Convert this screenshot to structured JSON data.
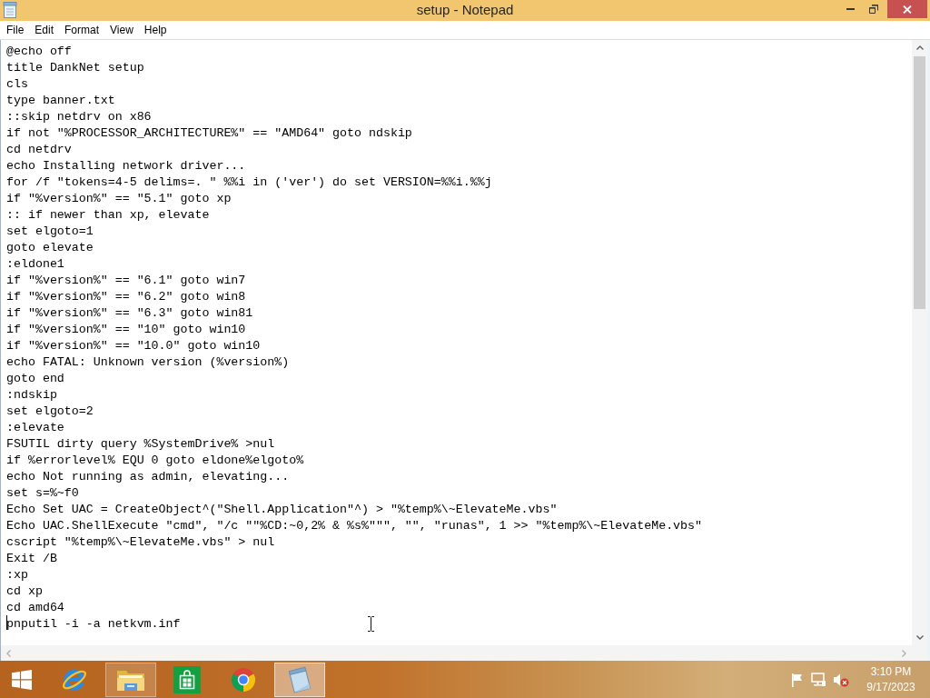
{
  "window": {
    "title": "setup - Notepad"
  },
  "menu": [
    "File",
    "Edit",
    "Format",
    "View",
    "Help"
  ],
  "lines": [
    {
      "text": "@echo off",
      "caret": false
    },
    {
      "text": "title DankNet setup",
      "caret": false
    },
    {
      "text": "cls",
      "caret": false
    },
    {
      "text": "type banner.txt",
      "caret": false
    },
    {
      "text": "::skip netdrv on x86",
      "caret": false
    },
    {
      "text": "if not \"%PROCESSOR_ARCHITECTURE%\" == \"AMD64\" goto ndskip",
      "caret": false
    },
    {
      "text": "cd netdrv",
      "caret": false
    },
    {
      "text": "echo Installing network driver...",
      "caret": false
    },
    {
      "text": "for /f \"tokens=4-5 delims=. \" %%i in ('ver') do set VERSION=%%i.%%j",
      "caret": false
    },
    {
      "text": "if \"%version%\" == \"5.1\" goto xp",
      "caret": false
    },
    {
      "text": ":: if newer than xp, elevate",
      "caret": false
    },
    {
      "text": "set elgoto=1",
      "caret": false
    },
    {
      "text": "goto elevate",
      "caret": false
    },
    {
      "text": ":eldone1",
      "caret": false
    },
    {
      "text": "if \"%version%\" == \"6.1\" goto win7",
      "caret": false
    },
    {
      "text": "if \"%version%\" == \"6.2\" goto win8",
      "caret": false
    },
    {
      "text": "if \"%version%\" == \"6.3\" goto win81",
      "caret": false
    },
    {
      "text": "if \"%version%\" == \"10\" goto win10",
      "caret": false
    },
    {
      "text": "if \"%version%\" == \"10.0\" goto win10",
      "caret": false
    },
    {
      "text": "echo FATAL: Unknown version (%version%)",
      "caret": false
    },
    {
      "text": "goto end",
      "caret": false
    },
    {
      "text": ":ndskip",
      "caret": false
    },
    {
      "text": "set elgoto=2",
      "caret": false
    },
    {
      "text": ":elevate",
      "caret": false
    },
    {
      "text": "FSUTIL dirty query %SystemDrive% >nul",
      "caret": false
    },
    {
      "text": "if %errorlevel% EQU 0 goto eldone%elgoto%",
      "caret": false
    },
    {
      "text": "echo Not running as admin, elevating...",
      "caret": false
    },
    {
      "text": "set s=%~f0",
      "caret": false
    },
    {
      "text": "Echo Set UAC = CreateObject^(\"Shell.Application\"^) > \"%temp%\\~ElevateMe.vbs\"",
      "caret": false
    },
    {
      "text": "Echo UAC.ShellExecute \"cmd\", \"/c \"\"%CD:~0,2% & %s%\"\"\", \"\", \"runas\", 1 >> \"%temp%\\~ElevateMe.vbs\"",
      "caret": false
    },
    {
      "text": "cscript \"%temp%\\~ElevateMe.vbs\" > nul",
      "caret": false
    },
    {
      "text": "Exit /B",
      "caret": false
    },
    {
      "text": ":xp",
      "caret": false
    },
    {
      "text": "cd xp",
      "caret": false
    },
    {
      "text": "cd amd64",
      "caret": false
    },
    {
      "text": "pnputil -i -a netkvm.inf",
      "caret": true
    }
  ],
  "taskbar": {
    "apps": [
      {
        "kind": "start",
        "running": false,
        "active": false
      },
      {
        "kind": "ie",
        "running": false,
        "active": false
      },
      {
        "kind": "explorer",
        "running": true,
        "active": false
      },
      {
        "kind": "store",
        "running": false,
        "active": false
      },
      {
        "kind": "chrome",
        "running": false,
        "active": false
      },
      {
        "kind": "notepad",
        "running": true,
        "active": true
      }
    ],
    "tray": {
      "volume": {
        "muted": true
      }
    },
    "clock": {
      "time": "3:10 PM",
      "date": "9/17/2023"
    }
  }
}
